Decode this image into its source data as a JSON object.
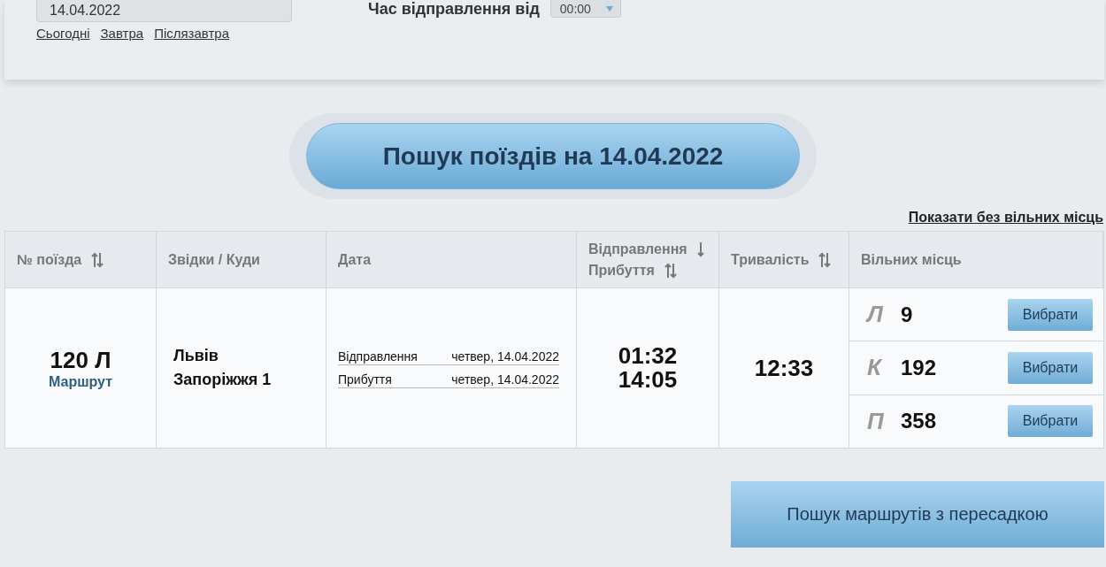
{
  "search_form": {
    "date_field": {
      "value": "14.04.2022"
    },
    "quick_dates": [
      "Сьогодні",
      "Завтра",
      "Післязавтра"
    ],
    "departure_time": {
      "label": "Час відправлення від",
      "value": "00:00"
    }
  },
  "search_button": "Пошук поїздів на 14.04.2022",
  "show_without_seats_link": "Показати без вільних місць",
  "table": {
    "columns": [
      {
        "lines": [
          {
            "label": "№ поїзда",
            "kind": "sortable"
          }
        ]
      },
      {
        "lines": [
          {
            "label": "Звідки / Куди",
            "kind": "plain"
          }
        ]
      },
      {
        "lines": [
          {
            "label": "Дата",
            "kind": "plain"
          }
        ]
      },
      {
        "lines": [
          {
            "label": "Відправлення",
            "kind": "sorted"
          },
          {
            "label": "Прибуття",
            "kind": "sortable"
          }
        ]
      },
      {
        "lines": [
          {
            "label": "Тривалість",
            "kind": "sortable"
          }
        ]
      },
      {
        "lines": [
          {
            "label": "Вільних місць",
            "kind": "plain"
          }
        ]
      }
    ],
    "rows": [
      {
        "train": "120 Л",
        "route_link": "Маршрут",
        "from": "Львів",
        "to": "Запоріжжя 1",
        "dates": [
          {
            "label": "Відправлення",
            "value": "четвер, 14.04.2022"
          },
          {
            "label": "Прибуття",
            "value": "четвер, 14.04.2022"
          }
        ],
        "departure": "01:32",
        "arrival": "14:05",
        "duration": "12:33",
        "seats": [
          {
            "class": "Л",
            "count": "9",
            "button": "Вибрати"
          },
          {
            "class": "К",
            "count": "192",
            "button": "Вибрати"
          },
          {
            "class": "П",
            "count": "358",
            "button": "Вибрати"
          }
        ]
      }
    ]
  },
  "transfer_button": "Пошук маршрутів з пересадкою"
}
